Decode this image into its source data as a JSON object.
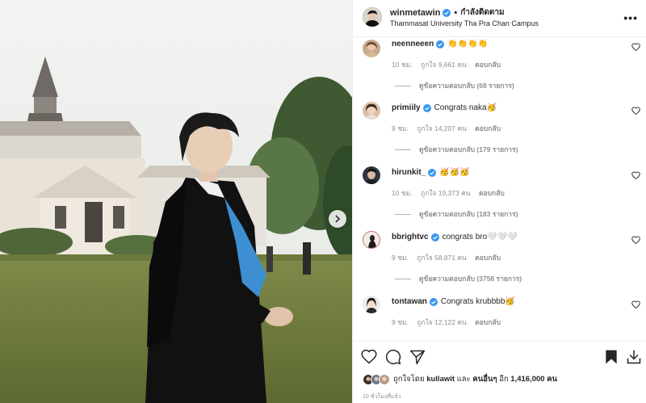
{
  "post": {
    "username": "winmetawin",
    "follow_label": "กำลังติดตาม",
    "location": "Thammasat University Tha Pra Chan Campus",
    "more_label": "•••"
  },
  "comments": [
    {
      "user": "neenneeen",
      "text": "👏👏👏👏",
      "time": "10 ชม.",
      "likes": "ถูกใจ 9,661 คน",
      "reply": "ตอบกลับ",
      "view_replies": "ดูข้อความตอบกลับ (68 รายการ)"
    },
    {
      "user": "primiily",
      "text": "Congrats naka🥳",
      "time": "9 ชม.",
      "likes": "ถูกใจ 14,207 คน",
      "reply": "ตอบกลับ",
      "view_replies": "ดูข้อความตอบกลับ (179 รายการ)"
    },
    {
      "user": "hirunkit_",
      "text": "🥳🥳🥳",
      "time": "10 ชม.",
      "likes": "ถูกใจ 19,373 คน",
      "reply": "ตอบกลับ",
      "view_replies": "ดูข้อความตอบกลับ (183 รายการ)"
    },
    {
      "user": "bbrightvc",
      "text": "congrats bro🤍🤍🤍",
      "time": "9 ชม.",
      "likes": "ถูกใจ 58,871 คน",
      "reply": "ตอบกลับ",
      "view_replies": "ดูข้อความตอบกลับ (3758 รายการ)"
    },
    {
      "user": "tontawan",
      "text": "Congrats krubbbb🥳",
      "time": "9 ชม.",
      "likes": "ถูกใจ 12,122 คน",
      "reply": "ตอบกลับ",
      "view_replies": ""
    }
  ],
  "likes": {
    "prefix": "ถูกใจโดย",
    "user": "kullawit",
    "and": "และ",
    "others": "คนอื่นๆ",
    "more": "อีก",
    "count": "1,416,000 คน"
  },
  "timestamp": "10 ชั่วโมงที่แล้ว",
  "icons": {
    "heart": "heart-icon",
    "comment": "comment-icon",
    "share": "share-icon",
    "bookmark": "bookmark-icon",
    "download": "download-icon",
    "verified": "verified-badge-icon",
    "next": "chevron-right-icon"
  },
  "colors": {
    "verified": "#3897f0",
    "text": "#262626",
    "muted": "#8e8e8e",
    "gown": "#111111",
    "sash": "#3d8fd1",
    "grass": "#6f7a3e"
  }
}
